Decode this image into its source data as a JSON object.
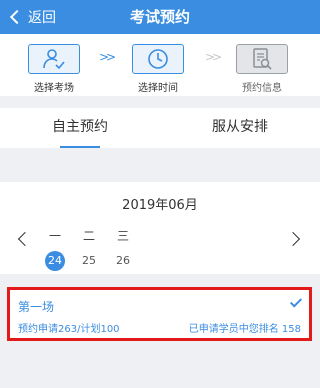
{
  "header": {
    "back_label": "返回",
    "title": "考试预约"
  },
  "steps": [
    {
      "label": "选择考场",
      "icon": "person-check-icon",
      "state": "active"
    },
    {
      "label": "选择时间",
      "icon": "clock-icon",
      "state": "active"
    },
    {
      "label": "预约信息",
      "icon": "document-search-icon",
      "state": "inactive"
    }
  ],
  "tabs": [
    {
      "label": "自主预约",
      "selected": true
    },
    {
      "label": "服从安排",
      "selected": false
    }
  ],
  "calendar": {
    "month": "2019年06月",
    "days": [
      {
        "weekday": "一",
        "date": "24",
        "selected": true
      },
      {
        "weekday": "二",
        "date": "25",
        "selected": false
      },
      {
        "weekday": "三",
        "date": "26",
        "selected": false
      }
    ]
  },
  "session": {
    "name": "第一场",
    "quota": "预约申请263/计划100",
    "rank": "已申请学员中您排名  158",
    "checked": true
  },
  "colors": {
    "primary": "#3a8de0",
    "highlight": "#e31a1a"
  }
}
